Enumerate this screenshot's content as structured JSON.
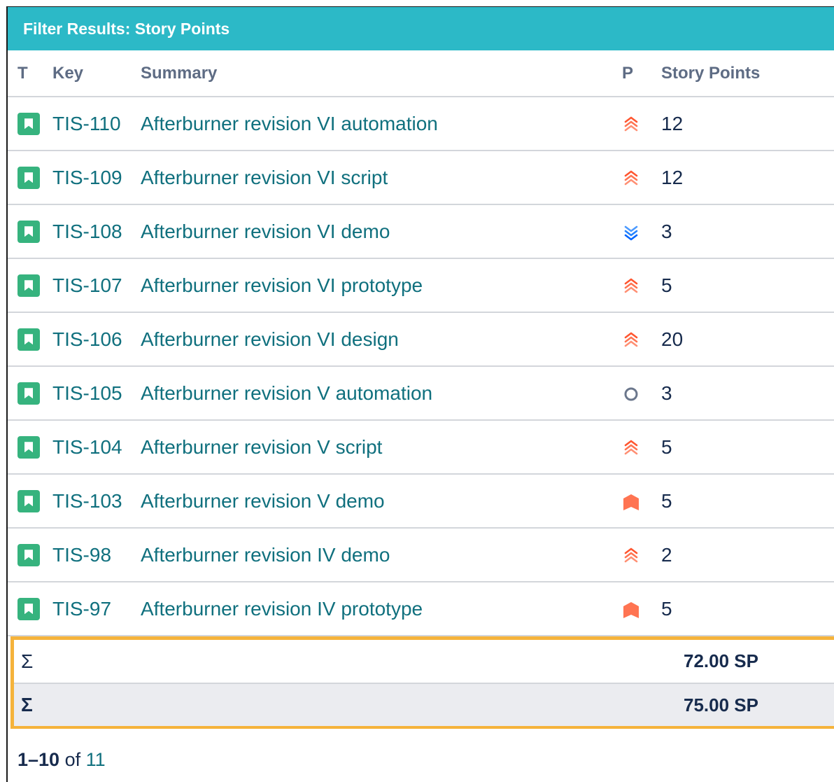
{
  "gadget": {
    "title": "Filter Results: Story Points"
  },
  "columns": {
    "type": "T",
    "key": "Key",
    "summary": "Summary",
    "priority": "P",
    "story_points": "Story Points"
  },
  "rows": [
    {
      "key": "TIS-110",
      "summary": "Afterburner revision VI automation",
      "priority": "highest",
      "sp": "12"
    },
    {
      "key": "TIS-109",
      "summary": "Afterburner revision VI script",
      "priority": "highest",
      "sp": "12"
    },
    {
      "key": "TIS-108",
      "summary": "Afterburner revision VI demo",
      "priority": "lowest",
      "sp": "3"
    },
    {
      "key": "TIS-107",
      "summary": "Afterburner revision VI prototype",
      "priority": "highest",
      "sp": "5"
    },
    {
      "key": "TIS-106",
      "summary": "Afterburner revision VI design",
      "priority": "highest",
      "sp": "20"
    },
    {
      "key": "TIS-105",
      "summary": "Afterburner revision V automation",
      "priority": "none",
      "sp": "3"
    },
    {
      "key": "TIS-104",
      "summary": "Afterburner revision V script",
      "priority": "highest",
      "sp": "5"
    },
    {
      "key": "TIS-103",
      "summary": "Afterburner revision V demo",
      "priority": "blocker",
      "sp": "5"
    },
    {
      "key": "TIS-98",
      "summary": "Afterburner revision IV demo",
      "priority": "highest",
      "sp": "2"
    },
    {
      "key": "TIS-97",
      "summary": "Afterburner revision IV prototype",
      "priority": "blocker",
      "sp": "5"
    }
  ],
  "totals": [
    {
      "symbol": "Σ",
      "value": "72.00 SP"
    },
    {
      "symbol": "Σ",
      "value": "75.00 SP"
    }
  ],
  "pagination": {
    "range": "1–10",
    "of": "of",
    "total": "11"
  },
  "colors": {
    "header": "#2cb9c7",
    "link": "#10707e",
    "story_icon": "#36b37e",
    "priority_high": "#ff5630",
    "priority_low": "#2684ff",
    "highlight": "#f5b33b"
  }
}
